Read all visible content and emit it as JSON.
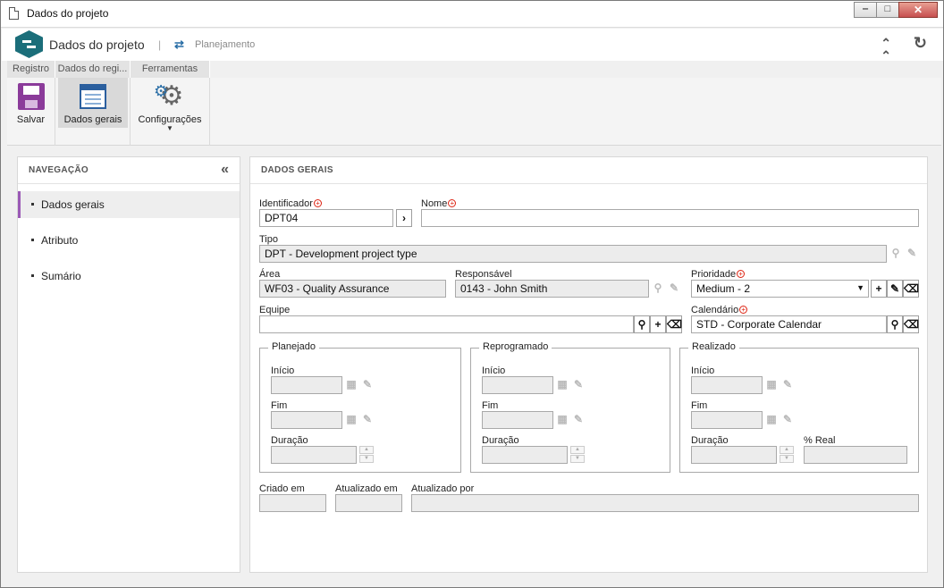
{
  "window": {
    "title": "Dados do projeto",
    "minimize": "‒",
    "maximize": "□",
    "close": "✕"
  },
  "header": {
    "title": "Dados do projeto",
    "separator": "|",
    "module": "Planejamento"
  },
  "ribbon": {
    "tabs": [
      "Registro",
      "Dados do regi...",
      "Ferramentas"
    ],
    "buttons": {
      "save": "Salvar",
      "general": "Dados gerais",
      "config": "Configurações"
    }
  },
  "nav": {
    "title": "NAVEGAÇÃO",
    "items": [
      "Dados gerais",
      "Atributo",
      "Sumário"
    ]
  },
  "main": {
    "title": "DADOS GERAIS",
    "identificador": {
      "label": "Identificador",
      "value": "DPT04"
    },
    "nome": {
      "label": "Nome",
      "value": ""
    },
    "tipo": {
      "label": "Tipo",
      "value": "DPT - Development project type"
    },
    "area": {
      "label": "Área",
      "value": "WF03 - Quality Assurance"
    },
    "responsavel": {
      "label": "Responsável",
      "value": "0143 - John Smith"
    },
    "prioridade": {
      "label": "Prioridade",
      "value": "Medium - 2"
    },
    "equipe": {
      "label": "Equipe",
      "value": ""
    },
    "calendario": {
      "label": "Calendário",
      "value": "STD - Corporate Calendar"
    },
    "planejado": {
      "legend": "Planejado",
      "inicio": "Início",
      "fim": "Fim",
      "duracao": "Duração"
    },
    "reprogramado": {
      "legend": "Reprogramado",
      "inicio": "Início",
      "fim": "Fim",
      "duracao": "Duração"
    },
    "realizado": {
      "legend": "Realizado",
      "inicio": "Início",
      "fim": "Fim",
      "duracao": "Duração",
      "real": "% Real"
    },
    "criado_em": "Criado em",
    "atualizado_em": "Atualizado em",
    "atualizado_por": "Atualizado por"
  }
}
